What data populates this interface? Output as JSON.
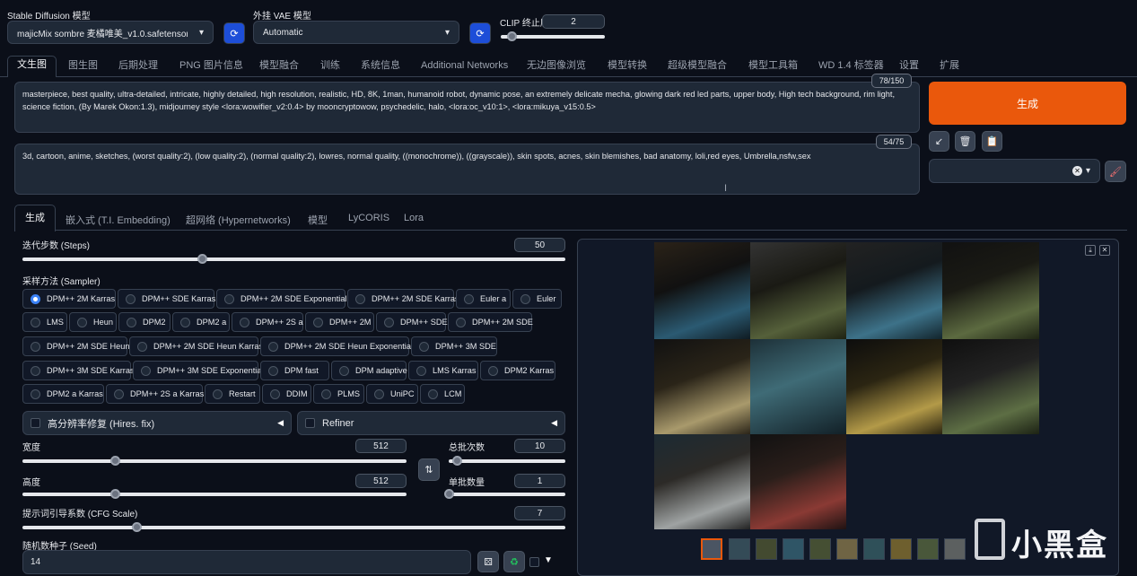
{
  "top": {
    "sd_model_label": "Stable Diffusion 模型",
    "sd_model_value": "majicMix sombre 麦橘唯美_v1.0.safetensors [c",
    "vae_label": "外挂 VAE 模型",
    "vae_value": "Automatic",
    "clip_label": "CLIP 终止层数",
    "clip_value": "2"
  },
  "tabs": [
    "文生图",
    "图生图",
    "后期处理",
    "PNG 图片信息",
    "模型融合",
    "训练",
    "系统信息",
    "Additional Networks",
    "无边图像浏览",
    "模型转换",
    "超级模型融合",
    "模型工具箱",
    "WD 1.4 标签器",
    "设置",
    "扩展"
  ],
  "prompt": {
    "positive": "masterpiece, best quality, ultra-detailed, intricate, highly detailed, high resolution, realistic, HD, 8K, 1man, humanoid robot, dynamic pose, an extremely delicate mecha, glowing dark red led parts, upper body, High tech background, rim light, science fiction, (By Marek Okon:1.3), midjourney style <lora:wowifier_v2:0.4> by mooncryptowow, psychedelic, halo, <lora:oc_v10:1>, <lora:mikuya_v15:0.5>",
    "positive_count": "78/150",
    "negative": "3d, cartoon, anime, sketches, (worst quality:2), (low quality:2), (normal quality:2), lowres, normal quality, ((monochrome)), ((grayscale)), skin spots, acnes, skin blemishes, bad anatomy, loli,red eyes, Umbrella,nsfw,sex",
    "negative_count": "54/75"
  },
  "generate_label": "生成",
  "subtabs": [
    "生成",
    "嵌入式 (T.I. Embedding)",
    "超网络 (Hypernetworks)",
    "模型",
    "LyCORIS",
    "Lora"
  ],
  "steps": {
    "label": "迭代步数 (Steps)",
    "value": "50",
    "fraction": 0.33
  },
  "sampler": {
    "label": "采样方法 (Sampler)",
    "selected": "DPM++ 2M Karras",
    "options": [
      "DPM++ 2M Karras",
      "DPM++ SDE Karras",
      "DPM++ 2M SDE Exponential",
      "DPM++ 2M SDE Karras",
      "Euler a",
      "Euler",
      "LMS",
      "Heun",
      "DPM2",
      "DPM2 a",
      "DPM++ 2S a",
      "DPM++ 2M",
      "DPM++ SDE",
      "DPM++ 2M SDE",
      "DPM++ 2M SDE Heun",
      "DPM++ 2M SDE Heun Karras",
      "DPM++ 2M SDE Heun Exponential",
      "DPM++ 3M SDE",
      "DPM++ 3M SDE Karras",
      "DPM++ 3M SDE Exponential",
      "DPM fast",
      "DPM adaptive",
      "LMS Karras",
      "DPM2 Karras",
      "DPM2 a Karras",
      "DPM++ 2S a Karras",
      "Restart",
      "DDIM",
      "PLMS",
      "UniPC",
      "LCM"
    ]
  },
  "hires_label": "高分辨率修复 (Hires. fix)",
  "refiner_label": "Refiner",
  "width": {
    "label": "宽度",
    "value": "512",
    "fraction": 0.24
  },
  "height": {
    "label": "高度",
    "value": "512",
    "fraction": 0.24
  },
  "batch_count": {
    "label": "总批次数",
    "value": "10",
    "fraction": 0.07
  },
  "batch_size": {
    "label": "单批数量",
    "value": "1",
    "fraction": 0.0
  },
  "cfg": {
    "label": "提示词引导系数 (CFG Scale)",
    "value": "7",
    "fraction": 0.21
  },
  "seed": {
    "label": "随机数种子 (Seed)",
    "value": "14"
  },
  "watermark": "小黑盒",
  "colors": {
    "accent": "#ea580c",
    "background": "#0b0f19",
    "panel": "#1f2937",
    "primary_blue": "#1d4ed8"
  }
}
